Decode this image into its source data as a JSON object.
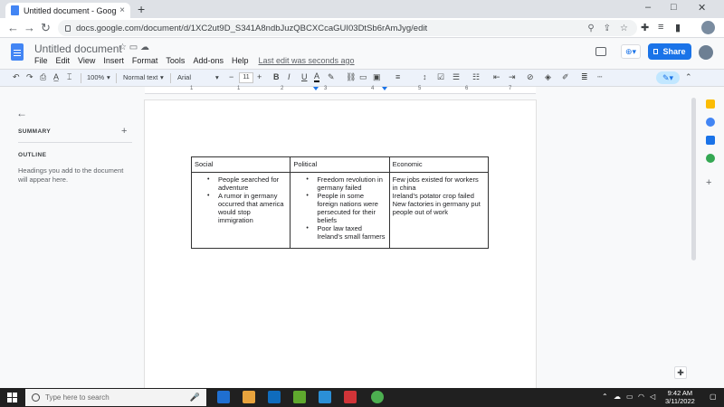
{
  "browser": {
    "tab_title": "Untitled document - Google Docs",
    "tab_close": "×",
    "new_tab": "+",
    "url": "docs.google.com/document/d/1XC2ut9D_S341A8ndbJuzQBCXCcaGUI03DtSb6rAmJyg/edit",
    "window_controls": [
      "–",
      "□",
      "✕"
    ]
  },
  "docs": {
    "title": "Untitled document",
    "menu": [
      "File",
      "Edit",
      "View",
      "Insert",
      "Format",
      "Tools",
      "Add-ons",
      "Help"
    ],
    "last_edit": "Last edit was seconds ago",
    "share_label": "Share"
  },
  "toolbar": {
    "zoom": "100%",
    "style": "Normal text",
    "font": "Arial",
    "font_size": "11",
    "bold": "B",
    "italic": "I",
    "underline": "U",
    "text_color": "A"
  },
  "ruler": {
    "numbers": [
      "1",
      "1",
      "2",
      "3",
      "4",
      "5",
      "6",
      "7"
    ]
  },
  "outline_panel": {
    "summary_label": "SUMMARY",
    "outline_label": "OUTLINE",
    "hint": "Headings you add to the document will appear here."
  },
  "document": {
    "table": {
      "headers": [
        "Social",
        "Political",
        "Economic"
      ],
      "social_bullets": [
        "People searched for adventure",
        "A rumor in germany occurred that america would stop immigration"
      ],
      "political_bullets": [
        "Freedom revolution in germany failed",
        "People in some foreign nations were persecuted for their beliefs",
        "Poor law taxed Ireland's small farmers"
      ],
      "economic_lines": [
        "Few jobs existed for workers in china",
        "Ireland's potator crop failed",
        "New factories in germany put people out of work"
      ]
    }
  },
  "taskbar": {
    "search_placeholder": "Type here to search",
    "time": "9:42 AM",
    "date": "3/11/2022"
  },
  "colors": {
    "accent": "#1a73e8",
    "share_button": "#1a73e8",
    "taskbar": "#202020"
  }
}
